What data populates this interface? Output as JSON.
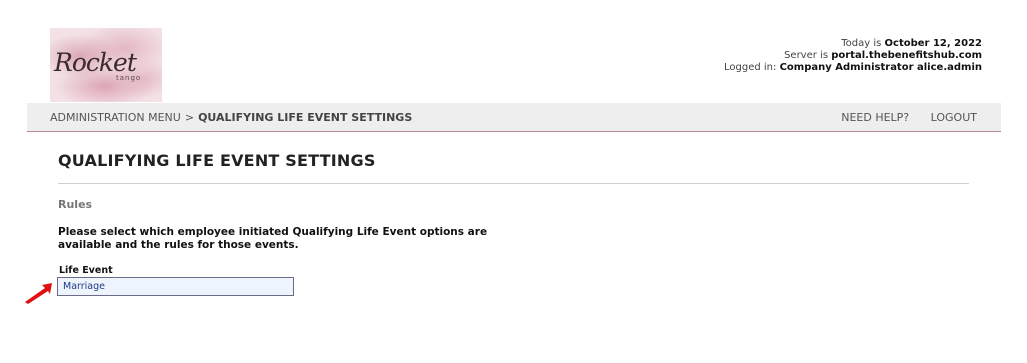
{
  "logo": {
    "main": "Rocket",
    "sub": "tango"
  },
  "server_info": {
    "today_prefix": "Today is ",
    "today_value": "October 12, 2022",
    "server_prefix": "Server is ",
    "server_value": "portal.thebenefitshub.com",
    "logged_prefix": "Logged in: ",
    "logged_value": "Company Administrator alice.admin"
  },
  "breadcrumb": {
    "parent": "ADMINISTRATION MENU",
    "separator": ">",
    "current": "QUALIFYING LIFE EVENT SETTINGS"
  },
  "nav": {
    "help": "NEED HELP?",
    "logout": "LOGOUT"
  },
  "page": {
    "title": "QUALIFYING LIFE EVENT SETTINGS",
    "section": "Rules",
    "description": "Please select which employee initiated Qualifying Life Event options are available and the rules for those events.",
    "field_label": "Life Event",
    "field_value": "Marriage"
  },
  "colors": {
    "navbar_bg": "#eeeeee",
    "navbar_border": "#b48a96",
    "field_bg": "#eef4fb",
    "field_text": "#1f3a8a",
    "arrow": "#e01010"
  },
  "icons": {
    "pointer": "red-arrow-icon"
  }
}
